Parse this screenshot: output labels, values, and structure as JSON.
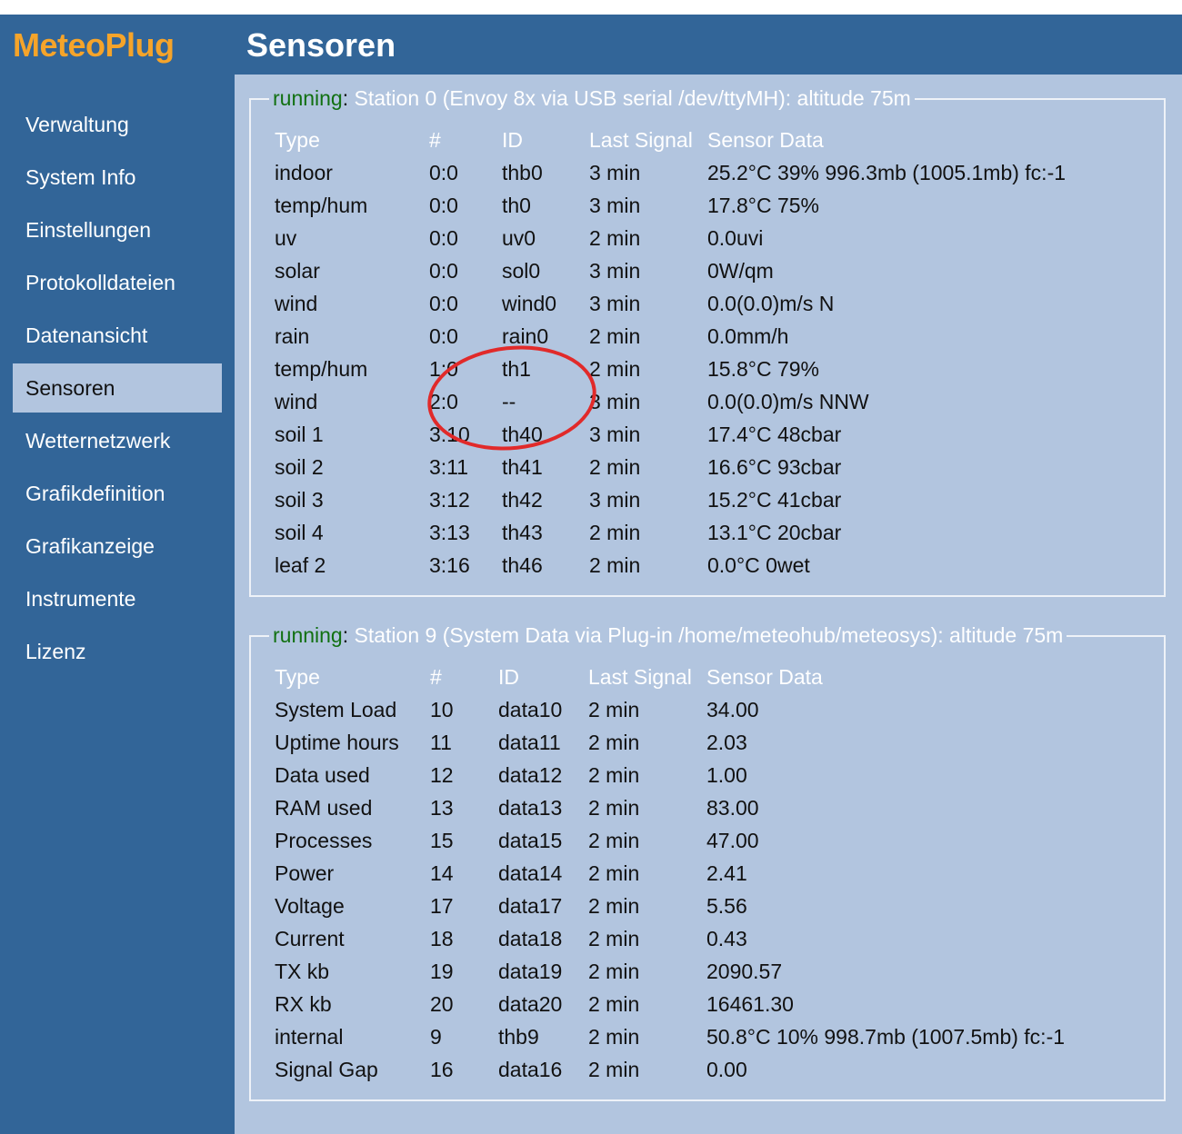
{
  "app": {
    "logo": "MeteoPlug",
    "page_title": "Sensoren"
  },
  "sidebar": {
    "active_index": 6,
    "items": [
      {
        "label": "Verwaltung"
      },
      {
        "label": "System Info"
      },
      {
        "label": "Einstellungen"
      },
      {
        "label": "Protokolldateien"
      },
      {
        "label": "Datenansicht"
      },
      {
        "label": "Sensoren"
      },
      {
        "label": "Wetternetzwerk"
      },
      {
        "label": "Grafikdefinition"
      },
      {
        "label": "Grafikanzeige"
      },
      {
        "label": "Instrumente"
      },
      {
        "label": "Lizenz"
      }
    ]
  },
  "columns": {
    "type": "Type",
    "num": "#",
    "id": "ID",
    "last_signal": "Last Signal",
    "sensor_data": "Sensor Data"
  },
  "stations": [
    {
      "status": "running",
      "description": "Station 0 (Envoy 8x via USB serial /dev/ttyMH): altitude 75m",
      "sensors": [
        {
          "type": "indoor",
          "num": "0:0",
          "id": "thb0",
          "last_signal": "3 min",
          "data": "25.2°C 39% 996.3mb (1005.1mb) fc:-1"
        },
        {
          "type": "temp/hum",
          "num": "0:0",
          "id": "th0",
          "last_signal": "3 min",
          "data": "17.8°C 75%"
        },
        {
          "type": "uv",
          "num": "0:0",
          "id": "uv0",
          "last_signal": "2 min",
          "data": "0.0uvi"
        },
        {
          "type": "solar",
          "num": "0:0",
          "id": "sol0",
          "last_signal": "3 min",
          "data": "0W/qm"
        },
        {
          "type": "wind",
          "num": "0:0",
          "id": "wind0",
          "last_signal": "3 min",
          "data": "0.0(0.0)m/s N"
        },
        {
          "type": "rain",
          "num": "0:0",
          "id": "rain0",
          "last_signal": "2 min",
          "data": "0.0mm/h"
        },
        {
          "type": "temp/hum",
          "num": "1:0",
          "id": "th1",
          "last_signal": "2 min",
          "data": "15.8°C 79%"
        },
        {
          "type": "wind",
          "num": "2:0",
          "id": "--",
          "last_signal": "3 min",
          "data": "0.0(0.0)m/s NNW"
        },
        {
          "type": "soil 1",
          "num": "3:10",
          "id": "th40",
          "last_signal": "3 min",
          "data": "17.4°C 48cbar"
        },
        {
          "type": "soil 2",
          "num": "3:11",
          "id": "th41",
          "last_signal": "2 min",
          "data": "16.6°C 93cbar"
        },
        {
          "type": "soil 3",
          "num": "3:12",
          "id": "th42",
          "last_signal": "3 min",
          "data": "15.2°C 41cbar"
        },
        {
          "type": "soil 4",
          "num": "3:13",
          "id": "th43",
          "last_signal": "2 min",
          "data": "13.1°C 20cbar"
        },
        {
          "type": "leaf 2",
          "num": "3:16",
          "id": "th46",
          "last_signal": "2 min",
          "data": "0.0°C 0wet"
        }
      ]
    },
    {
      "status": "running",
      "description": "Station 9 (System Data via Plug-in /home/meteohub/meteosys): altitude 75m",
      "sensors": [
        {
          "type": "System Load",
          "num": "10",
          "id": "data10",
          "last_signal": "2 min",
          "data": "34.00"
        },
        {
          "type": "Uptime hours",
          "num": "11",
          "id": "data11",
          "last_signal": "2 min",
          "data": "2.03"
        },
        {
          "type": "Data used",
          "num": "12",
          "id": "data12",
          "last_signal": "2 min",
          "data": "1.00"
        },
        {
          "type": "RAM used",
          "num": "13",
          "id": "data13",
          "last_signal": "2 min",
          "data": "83.00"
        },
        {
          "type": "Processes",
          "num": "15",
          "id": "data15",
          "last_signal": "2 min",
          "data": "47.00"
        },
        {
          "type": "Power",
          "num": "14",
          "id": "data14",
          "last_signal": "2 min",
          "data": "2.41"
        },
        {
          "type": "Voltage",
          "num": "17",
          "id": "data17",
          "last_signal": "2 min",
          "data": "5.56"
        },
        {
          "type": "Current",
          "num": "18",
          "id": "data18",
          "last_signal": "2 min",
          "data": "0.43"
        },
        {
          "type": "TX kb",
          "num": "19",
          "id": "data19",
          "last_signal": "2 min",
          "data": "2090.57"
        },
        {
          "type": "RX kb",
          "num": "20",
          "id": "data20",
          "last_signal": "2 min",
          "data": "16461.30"
        },
        {
          "type": "internal",
          "num": "9",
          "id": "thb9",
          "last_signal": "2 min",
          "data": "50.8°C 10% 998.7mb (1007.5mb) fc:-1"
        },
        {
          "type": "Signal Gap",
          "num": "16",
          "id": "data16",
          "last_signal": "2 min",
          "data": "0.00"
        }
      ]
    }
  ],
  "colors": {
    "background": "#326598",
    "panel": "#b2c5df",
    "logo": "#f5a42a",
    "status_running": "#117011",
    "annotation": "#e12a2a"
  }
}
